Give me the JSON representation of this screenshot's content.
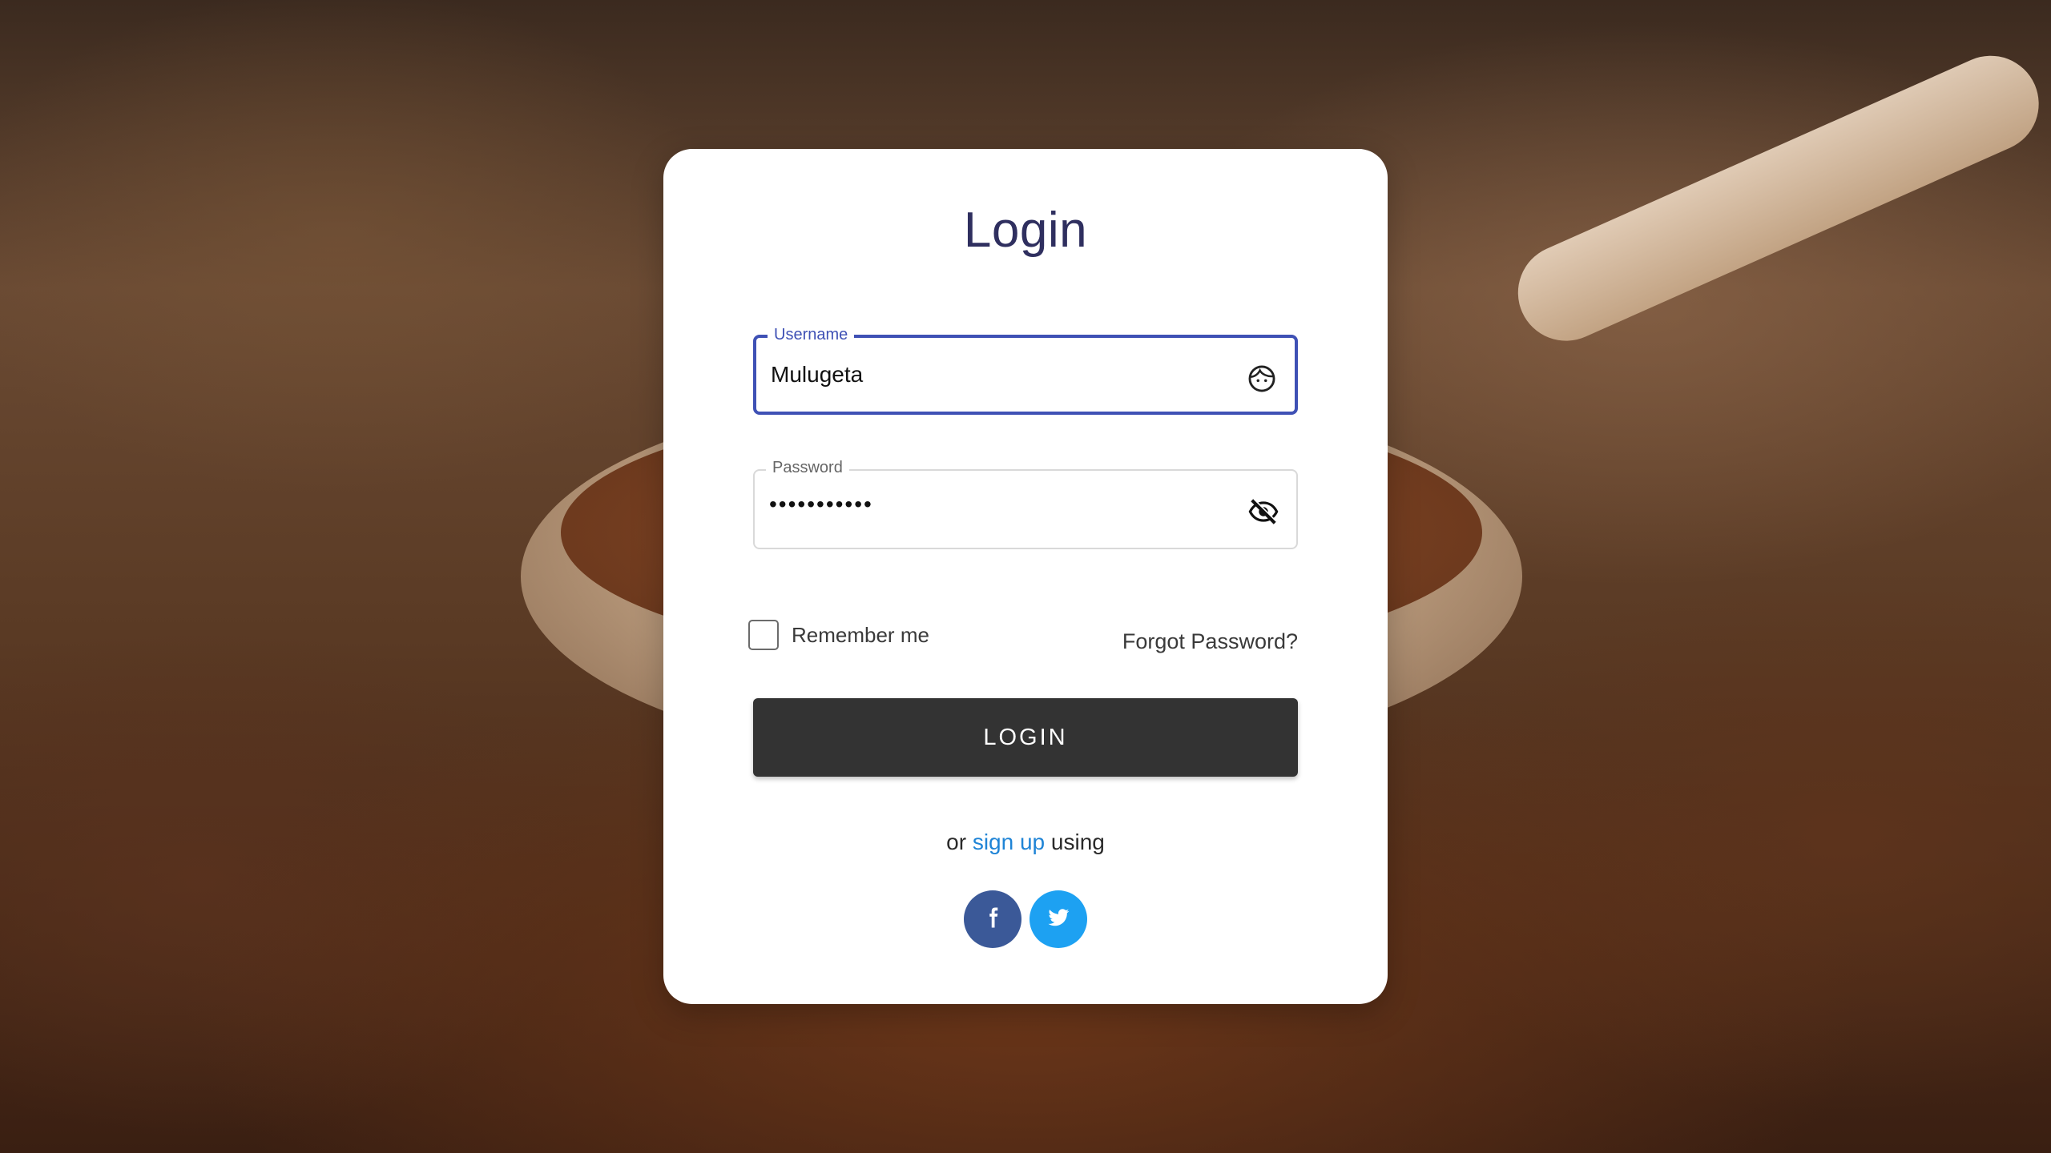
{
  "page": {
    "title": "Login"
  },
  "form": {
    "username": {
      "label": "Username",
      "value": "Mulugeta",
      "icon": "face-icon"
    },
    "password": {
      "label": "Password",
      "value": "•••••••••••",
      "icon": "visibility-off-icon"
    },
    "remember_label": "Remember me",
    "remember_checked": false,
    "forgot_label": "Forgot Password?",
    "login_label": "LOGIN"
  },
  "signup": {
    "prefix": "or",
    "link": "sign up",
    "suffix": "using"
  },
  "social": {
    "facebook_icon": "facebook-icon",
    "twitter_icon": "twitter-icon"
  },
  "colors": {
    "accent": "#3f51b5",
    "title": "#2f2f5f",
    "button": "#333333",
    "link": "#1f84d6",
    "facebook": "#3b5998",
    "twitter": "#1da1f2"
  }
}
